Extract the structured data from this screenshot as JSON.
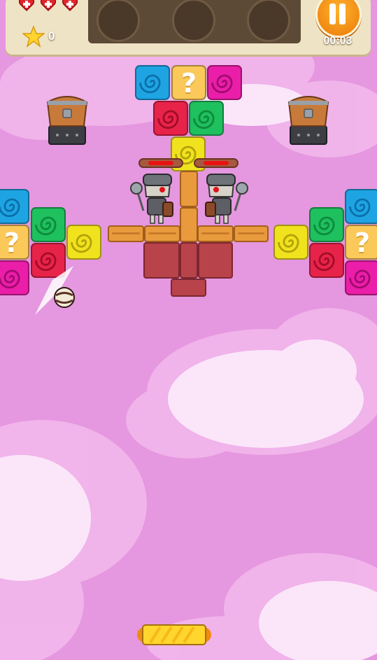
{
  "hud": {
    "lives": 3,
    "stars": "0",
    "timer": "00:03",
    "collection_slots": 3
  },
  "colors": {
    "background": "#e597df",
    "block_blue": "#1ea4e3",
    "block_magenta": "#ea1ea8",
    "block_red": "#e8234a",
    "block_green": "#1fc05e",
    "block_yellow": "#f1e21e",
    "block_question": "#fbc95a",
    "hp_bar": "#e81212",
    "pause_button": "#f08a12"
  },
  "icons": [
    "heart-icon",
    "star-icon",
    "pause-icon",
    "question-mark-icon",
    "treasure-chest-icon",
    "skeleton-warrior-icon",
    "ball-icon"
  ],
  "blocks": {
    "question_mark": "?"
  }
}
